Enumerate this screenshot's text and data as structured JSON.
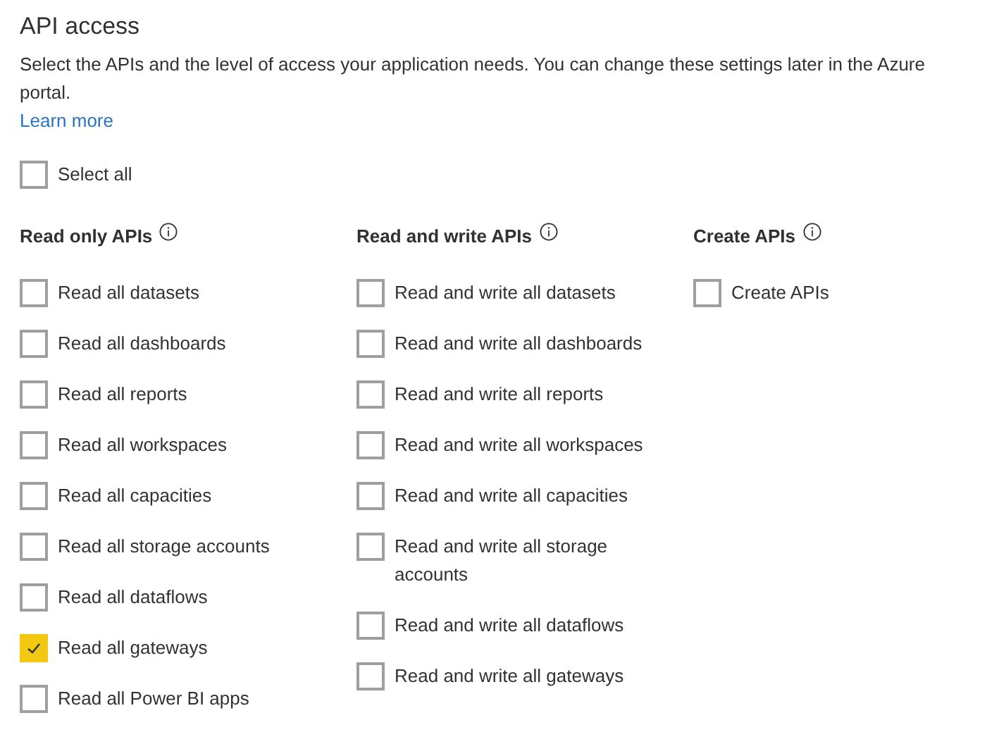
{
  "section": {
    "title": "API access",
    "description": "Select the APIs and the level of access your application needs. You can change these settings later in the Azure portal.",
    "link": "Learn more"
  },
  "select_all": {
    "label": "Select all",
    "checked": false
  },
  "columns": [
    {
      "heading": "Read only APIs",
      "items": [
        {
          "label": "Read all datasets",
          "checked": false
        },
        {
          "label": "Read all dashboards",
          "checked": false
        },
        {
          "label": "Read all reports",
          "checked": false
        },
        {
          "label": "Read all workspaces",
          "checked": false
        },
        {
          "label": "Read all capacities",
          "checked": false
        },
        {
          "label": "Read all storage accounts",
          "checked": false
        },
        {
          "label": "Read all dataflows",
          "checked": false
        },
        {
          "label": "Read all gateways",
          "checked": true
        },
        {
          "label": "Read all Power BI apps",
          "checked": false
        }
      ]
    },
    {
      "heading": "Read and write APIs",
      "items": [
        {
          "label": "Read and write all datasets",
          "checked": false
        },
        {
          "label": "Read and write all dashboards",
          "checked": false
        },
        {
          "label": "Read and write all reports",
          "checked": false
        },
        {
          "label": "Read and write all workspaces",
          "checked": false
        },
        {
          "label": "Read and write all capacities",
          "checked": false
        },
        {
          "label": "Read and write all storage accounts",
          "checked": false
        },
        {
          "label": "Read and write all dataflows",
          "checked": false
        },
        {
          "label": "Read and write all gateways",
          "checked": false
        }
      ]
    },
    {
      "heading": "Create APIs",
      "items": [
        {
          "label": "Create APIs",
          "checked": false
        }
      ]
    }
  ]
}
